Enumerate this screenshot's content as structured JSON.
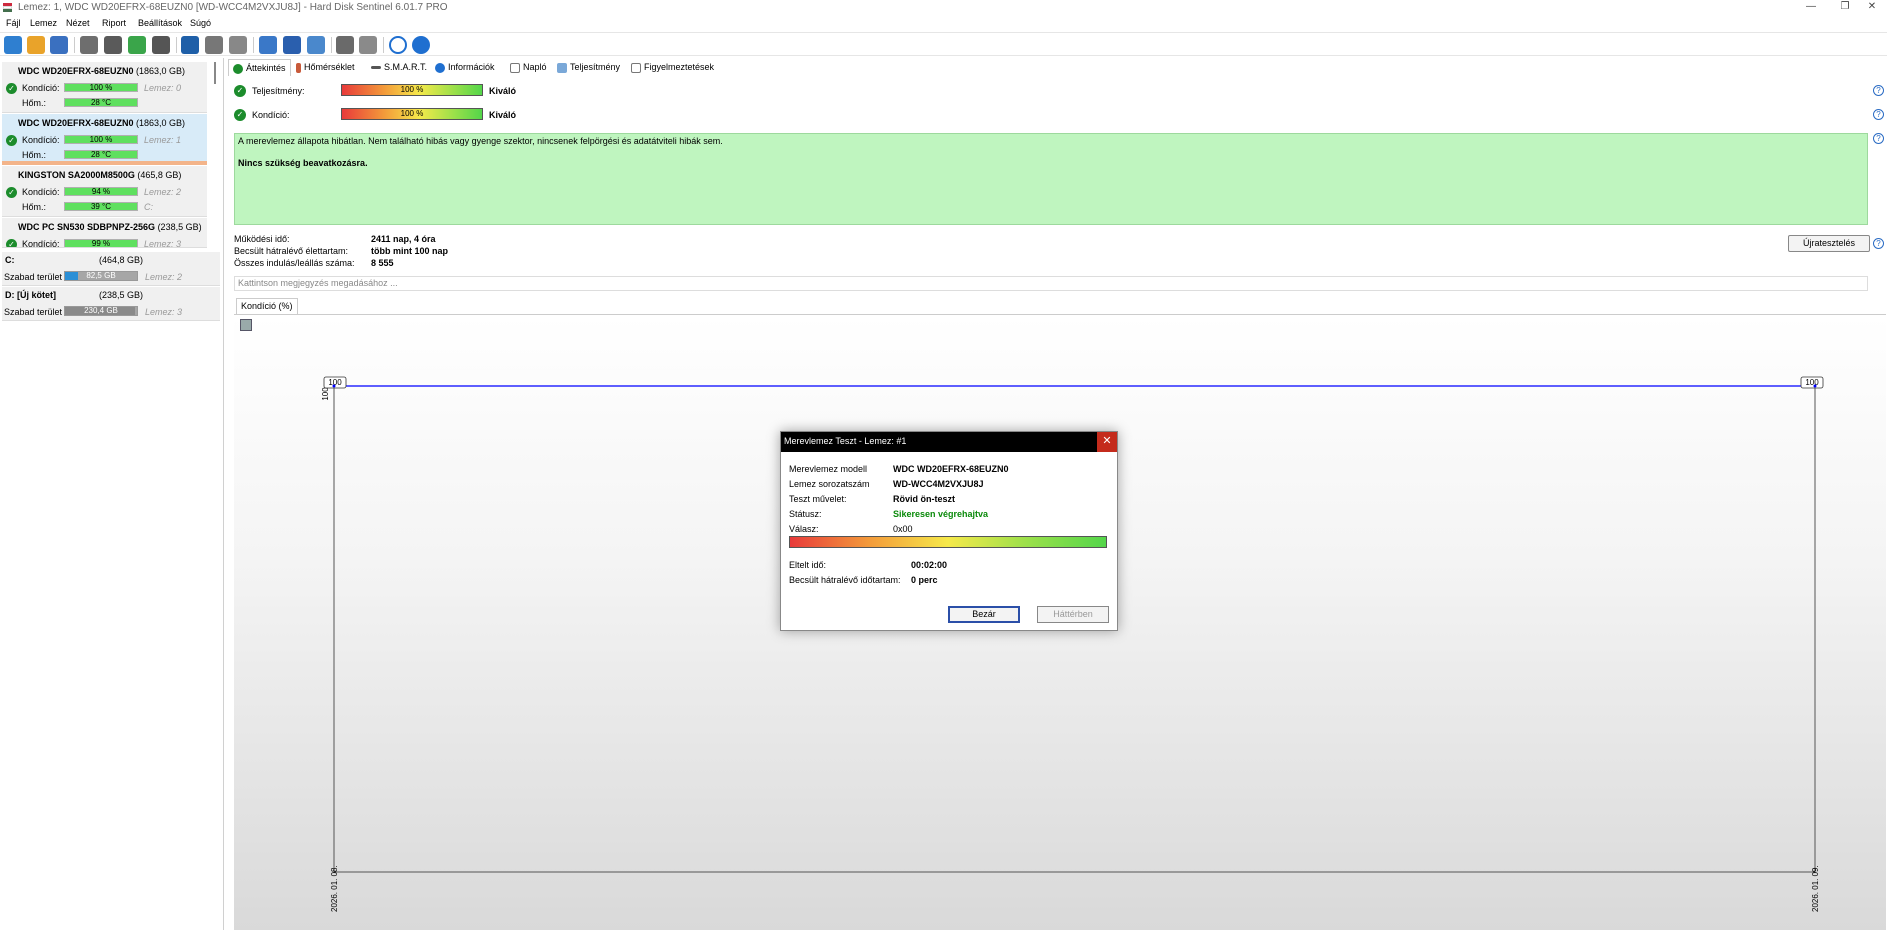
{
  "window": {
    "title": "Lemez: 1, WDC WD20EFRX-68EUZN0 [WD-WCC4M2VXJU8J] - Hard Disk Sentinel 6.01.7 PRO",
    "minimize": "—",
    "maximize": "❐",
    "close": "✕"
  },
  "menu": [
    "Fájl",
    "Lemez",
    "Nézet",
    "Riport",
    "Beállítások",
    "Súgó"
  ],
  "disks": [
    {
      "name": "WDC WD20EFRX-68EUZN0",
      "size": "(1863,0 GB)",
      "cond_label": "Kondíció:",
      "cond_value": "100 %",
      "cond_sub": "Lemez: 0",
      "temp_label": "Hőm.:",
      "temp_value": "28 °C",
      "temp_sub": ""
    },
    {
      "name": "WDC WD20EFRX-68EUZN0",
      "size": "(1863,0 GB)",
      "cond_label": "Kondíció:",
      "cond_value": "100 %",
      "cond_sub": "Lemez: 1",
      "temp_label": "Hőm.:",
      "temp_value": "28 °C",
      "temp_sub": ""
    },
    {
      "name": "KINGSTON SA2000M8500G",
      "size": "(465,8 GB)",
      "cond_label": "Kondíció:",
      "cond_value": "94 %",
      "cond_sub": "Lemez: 2",
      "temp_label": "Hőm.:",
      "temp_value": "39 °C",
      "temp_sub": "C:"
    },
    {
      "name": "WDC PC SN530 SDBPNPZ-256G",
      "size": "(238,5 GB)",
      "cond_label": "Kondíció:",
      "cond_value": "99 %",
      "cond_sub": "Lemez: 3"
    }
  ],
  "volumes": [
    {
      "name": "C:",
      "size": "(464,8 GB)",
      "free_label": "Szabad terület",
      "free_value": "82,5 GB",
      "free_fraction": 0.18,
      "color": "#2b8fd6",
      "sub": "Lemez: 2"
    },
    {
      "name": "D: [Új kötet]",
      "size": "(238,5 GB)",
      "free_label": "Szabad terület",
      "free_value": "230,4 GB",
      "free_fraction": 0.97,
      "color": "#8a8a8a",
      "sub": "Lemez: 3"
    }
  ],
  "tabs": [
    "Áttekintés",
    "Hőmérséklet",
    "S.M.A.R.T.",
    "Információk",
    "Napló",
    "Teljesítmény",
    "Figyelmeztetések"
  ],
  "health": {
    "perf_label": "Teljesítmény:",
    "perf_value": "100 %",
    "perf_result": "Kiváló",
    "cond_label": "Kondíció:",
    "cond_value": "100 %",
    "cond_result": "Kiváló"
  },
  "message": {
    "line1": "A merevlemez állapota hibátlan. Nem található hibás vagy gyenge szektor, nincsenek felpörgési és adatátviteli hibák sem.",
    "line2": "Nincs szükség beavatkozásra."
  },
  "info": {
    "uptime_label": "Működési idő:",
    "uptime_value": "2411 nap, 4 óra",
    "remaining_label": "Becsült hátralévő élettartam:",
    "remaining_value": "több mint 100 nap",
    "starts_label": "Összes indulás/leállás száma:",
    "starts_value": "8 555"
  },
  "retest_button": "Újratesztelés",
  "note_placeholder": "Kattintson megjegyzés megadásához ...",
  "chart_tab": "Kondíció  (%)",
  "chart_data": {
    "type": "line",
    "x": [
      "2026. 01. 08.",
      "2026. 01. 09."
    ],
    "series": [
      {
        "values": [
          100,
          100
        ],
        "color": "#0000ff"
      }
    ],
    "point_labels": [
      "100",
      "100"
    ],
    "y_tick": "100",
    "ylim": [
      0,
      100
    ]
  },
  "dialog": {
    "title": "Merevlemez Teszt - Lemez: #1",
    "model_label": "Merevlemez modell",
    "model_value": "WDC WD20EFRX-68EUZN0",
    "serial_label": "Lemez sorozatszám",
    "serial_value": "WD-WCC4M2VXJU8J",
    "op_label": "Teszt művelet:",
    "op_value": "Rövid ön-teszt",
    "status_label": "Státusz:",
    "status_value": "Sikeresen végrehajtva",
    "status_color": "#0a8a0a",
    "answer_label": "Válasz:",
    "answer_value": "0x00",
    "progress": 1.0,
    "elapsed_label": "Eltelt idő:",
    "elapsed_value": "00:02:00",
    "remain_label": "Becsült hátralévő időtartam:",
    "remain_value": "0 perc",
    "close_button": "Bezár",
    "background_button": "Háttérben"
  }
}
